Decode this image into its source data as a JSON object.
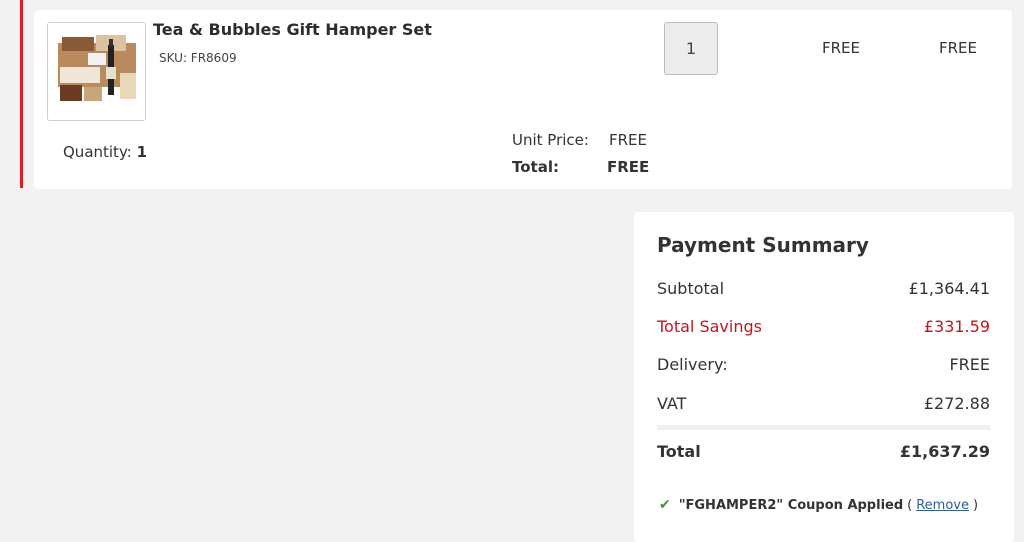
{
  "item": {
    "name": "Tea & Bubbles Gift Hamper Set",
    "sku": "SKU: FR8609",
    "quantity_value": "1",
    "unit_price_col": "FREE",
    "total_col": "FREE",
    "quantity_label": "Quantity:",
    "quantity_count": "1",
    "unit_price_label": "Unit Price:",
    "unit_price_value": "FREE",
    "line_total_label": "Total:",
    "line_total_value": "FREE",
    "image_icon": "gift-hamper-image"
  },
  "summary": {
    "title": "Payment Summary",
    "subtotal_label": "Subtotal",
    "subtotal_value": "£1,364.41",
    "savings_label": "Total Savings",
    "savings_value": "£331.59",
    "delivery_label": "Delivery:",
    "delivery_value": "FREE",
    "vat_label": "VAT",
    "vat_value": "£272.88",
    "total_label": "Total",
    "total_value": "£1,637.29",
    "coupon_text": "\"FGHAMPER2\" Coupon Applied",
    "coupon_open": "(",
    "coupon_remove": "Remove",
    "coupon_close": ")",
    "coupon_icon": "check-icon"
  },
  "colors": {
    "accent": "#d81e27",
    "savings": "#c8141e",
    "check": "#3a9a2d",
    "link": "#2f5d94"
  }
}
